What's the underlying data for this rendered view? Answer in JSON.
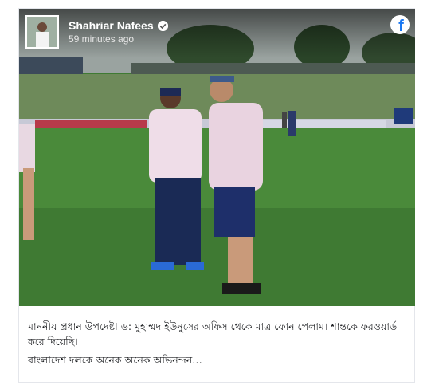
{
  "post": {
    "author_name": "Shahriar Nafees",
    "timestamp": "59 minutes ago",
    "platform_icon": "facebook-icon",
    "verified_icon": "verified-badge-icon",
    "caption_lines": [
      "মাননীয় প্রধান উপদেষ্টা ড: মুহাম্মদ ইউনুসের অফিস থেকে মাত্র ফোন পেলাম। শান্তকে ফরওয়ার্ড করে দিয়েছি।",
      "বাংলাদেশ দলকে অনেক অনেক অভিনন্দন…"
    ]
  },
  "colors": {
    "facebook_blue": "#1877f2",
    "grass_green": "#3f7a33",
    "text": "#1c1e21"
  }
}
